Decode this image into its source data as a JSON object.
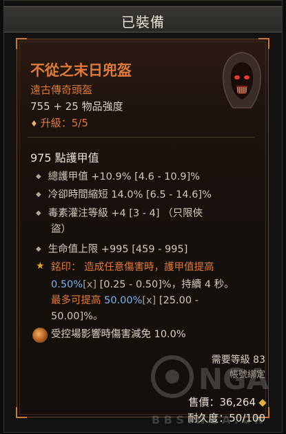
{
  "header": {
    "title": "已裝備"
  },
  "item": {
    "name": "不從之末日兜盔",
    "type": "遠古傳奇頭盔",
    "power": "755 + 25 物品強度",
    "upgrade": "升級：5/5",
    "armor": "975 點護甲值",
    "affixes": [
      "總護甲值 +10.9% [4.6 - 10.9]%",
      "冷卻時間縮短 14.0% [6.5 - 14.6]%",
      "毒素灌注等級 +4 [3 - 4] （只限俠",
      "盜）",
      "生命值上限 +995 [459 - 995]"
    ],
    "aspect": {
      "line1_prefix": "銘印： 造成任意傷害時，護甲值提高",
      "line2_blue": "0.50%",
      "line2_grey": "[x]",
      "line2_rest": " [0.25 - 0.50]%，持續 4 秒。",
      "line3_prefix": "最多可提高 ",
      "line3_blue": "50.00%",
      "line3_grey": "[x]",
      "line3_rest": " [25.00 -",
      "line4": "50.00]%。"
    },
    "gem": "受控場影響時傷害減免 10.0%",
    "required_level": "需要等級 83",
    "bound": "帳號綁定",
    "price": "售價：36,264",
    "durability": "耐久度：50/100"
  },
  "icons": {
    "helm": "hooded-skull-helm-icon",
    "gem": "gem-socket-icon",
    "coin": "gold-coin-icon",
    "bullet": "diamond-bullet-icon",
    "aspect_star": "star-icon"
  },
  "watermark_text": "NGA"
}
